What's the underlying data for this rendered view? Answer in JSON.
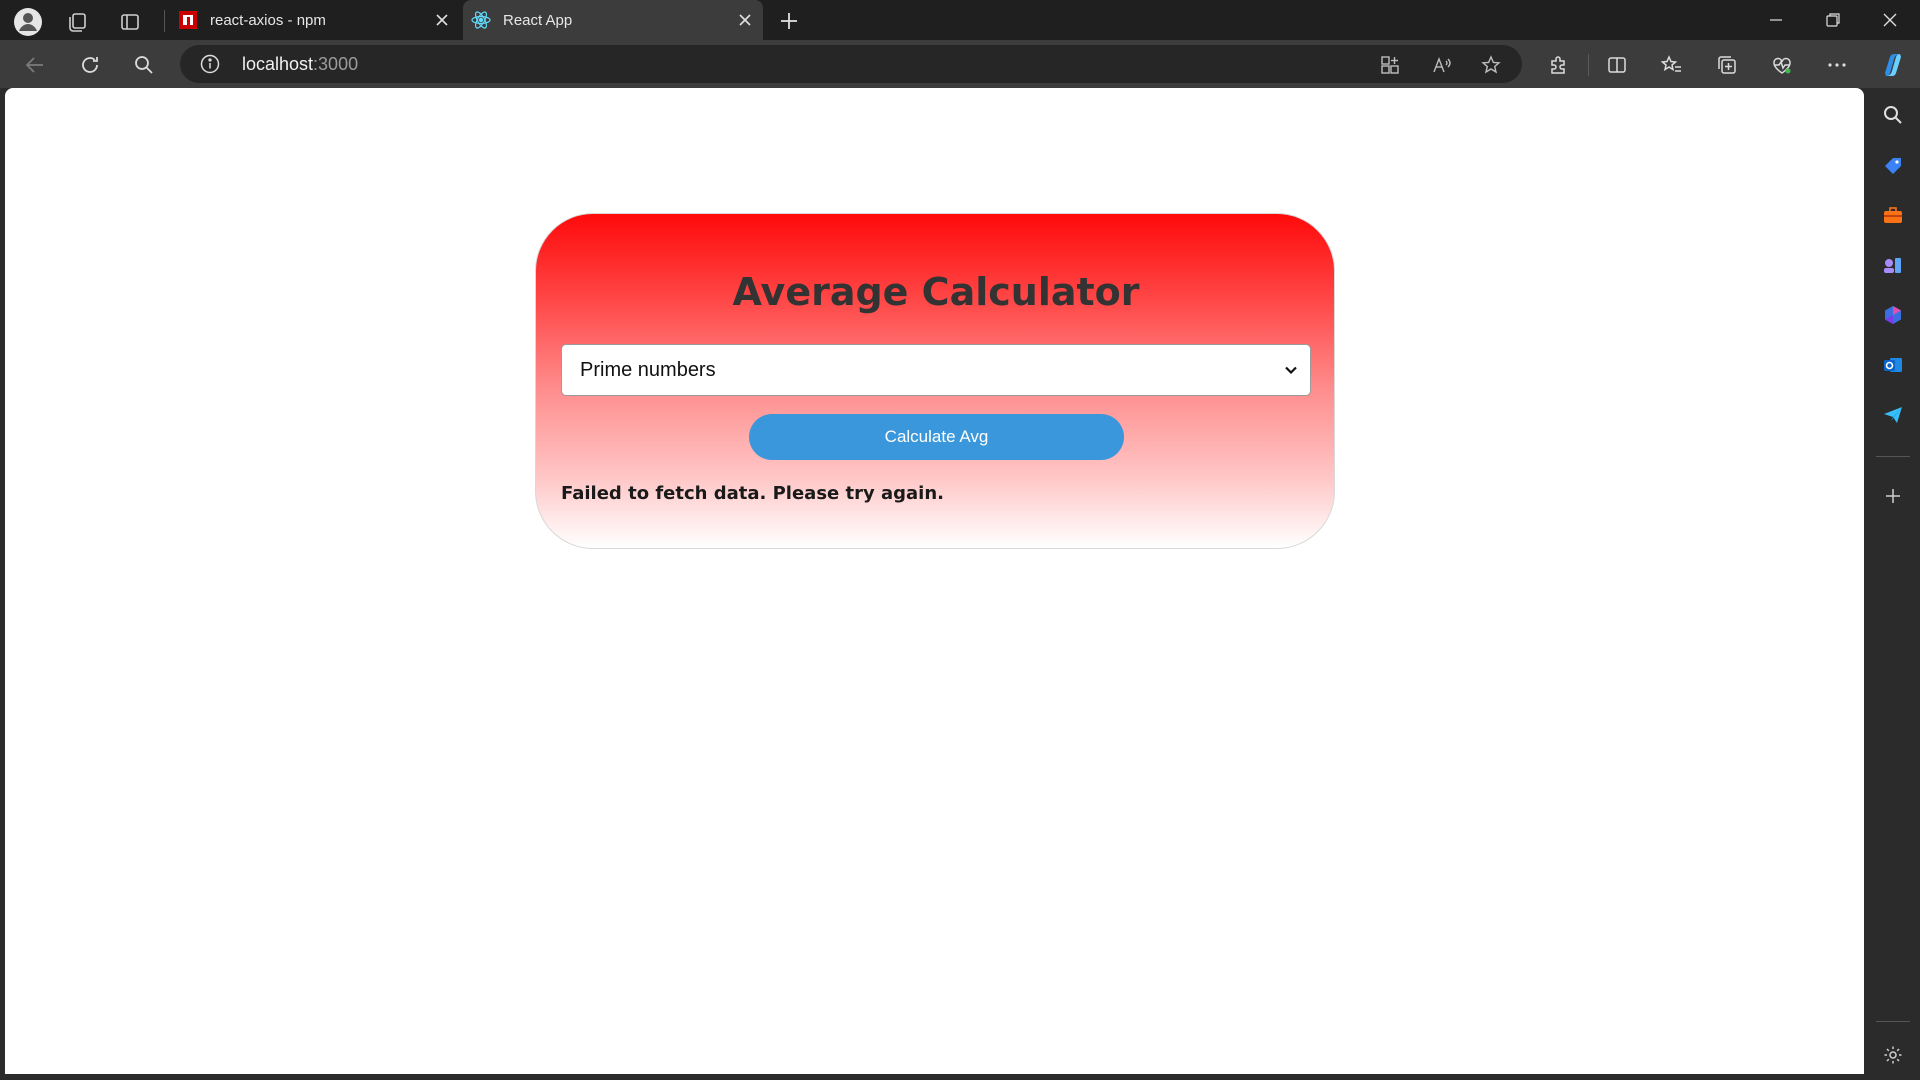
{
  "browser": {
    "tabs": [
      {
        "title": "react-axios - npm",
        "favicon": "npm-icon",
        "active": false
      },
      {
        "title": "React App",
        "favicon": "react-icon",
        "active": true
      }
    ],
    "address": {
      "host": "localhost",
      "port": ":3000"
    },
    "colors": {
      "tabstrip": "#1f1f1f",
      "toolbar": "#3c3c3c",
      "addressbar": "#262626"
    }
  },
  "app": {
    "title": "Average Calculator",
    "select": {
      "selected": "Prime numbers"
    },
    "button_label": "Calculate Avg",
    "error": "Failed to fetch data. Please try again.",
    "colors": {
      "gradient_top": "#ff0a0a",
      "button": "#3a97db",
      "title_text": "#333333"
    }
  }
}
